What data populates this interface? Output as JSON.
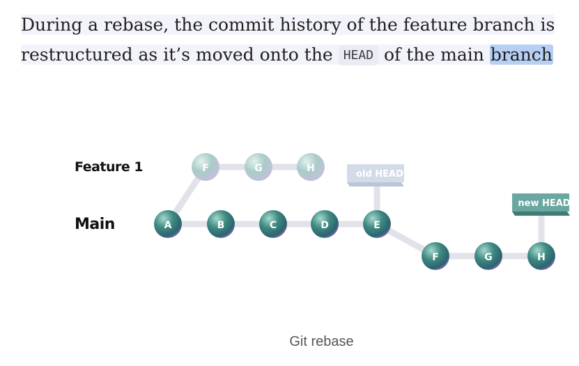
{
  "paragraph": {
    "part1": "During a rebase, the commit history of the feature branch is",
    "part2": "restructured as it’s moved onto the",
    "code": "HEAD",
    "part3": "of the main",
    "highlight": "branch"
  },
  "diagram": {
    "branch_feature_label": "Feature 1",
    "branch_main_label": "Main",
    "feature_commits": [
      "F",
      "G",
      "H"
    ],
    "main_commits": [
      "A",
      "B",
      "C",
      "D",
      "E"
    ],
    "rebased_commits": [
      "F",
      "G",
      "H"
    ],
    "old_head_label": "old HEAD",
    "new_head_label": "new HEAD",
    "colors": {
      "commit_dark": "#3f8a82",
      "commit_faded": "#a9ccc8",
      "edge": "#e2e2ea",
      "head_tag_faded": "#cfd8e6",
      "head_tag": "#6aa7a1"
    }
  },
  "caption": "Git rebase"
}
